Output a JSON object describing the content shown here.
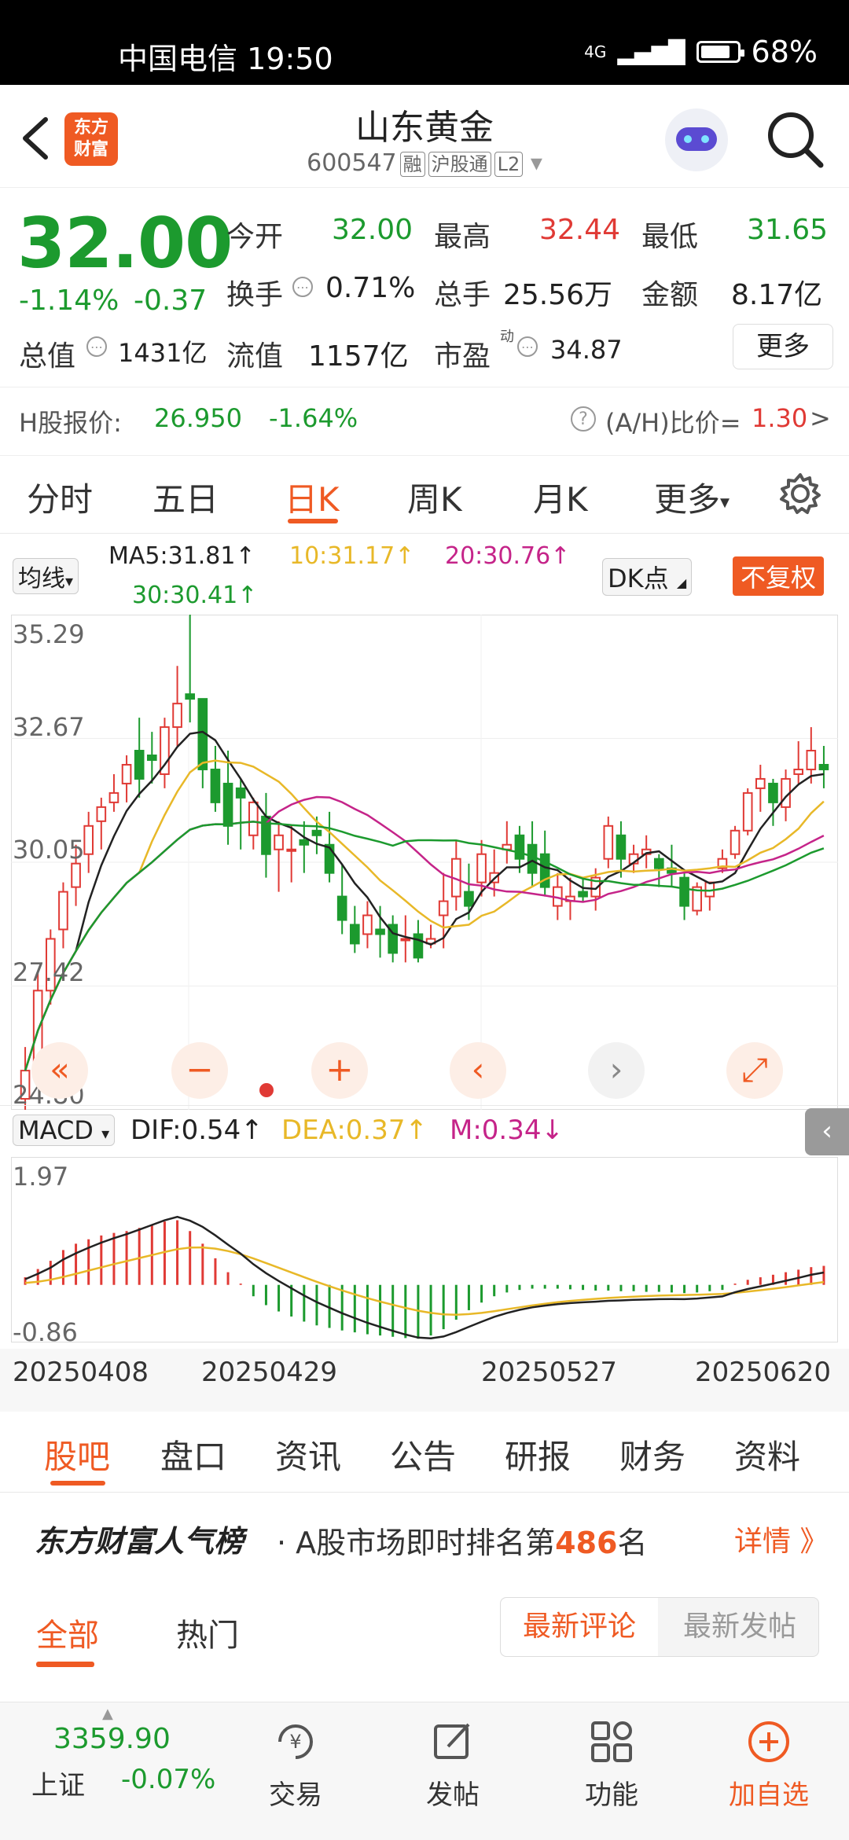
{
  "status": {
    "carrier": "中国电信",
    "time": "19:50",
    "network": "4G",
    "battery": "68%"
  },
  "header": {
    "logo_line1": "东方",
    "logo_line2": "财富",
    "title": "山东黄金",
    "code": "600547",
    "tags": [
      "融",
      "沪股通",
      "L2"
    ]
  },
  "quote": {
    "price": "32.00",
    "change_pct": "-1.14%",
    "change": "-0.37",
    "open_label": "今开",
    "open": "32.00",
    "high_label": "最高",
    "high": "32.44",
    "low_label": "最低",
    "low": "31.65",
    "turnover_label": "换手",
    "turnover": "0.71%",
    "volume_label": "总手",
    "volume": "25.56万",
    "amount_label": "金额",
    "amount": "8.17亿",
    "mcap_label": "总值",
    "mcap": "1431亿",
    "float_label": "流值",
    "float_cap": "1157亿",
    "pe_label": "市盈",
    "pe_sup": "动",
    "pe": "34.87",
    "more": "更多"
  },
  "hshare": {
    "label": "H股报价:",
    "price": "26.950",
    "pct": "-1.64%",
    "ratio_label": "(A/H)比价=",
    "ratio": "1.30",
    "arrow": ">"
  },
  "period_tabs": [
    "分时",
    "五日",
    "日K",
    "周K",
    "月K",
    "更多"
  ],
  "chart_header": {
    "ma_select": "均线",
    "ma5": "MA5:31.81↑",
    "ma10": "10:31.17↑",
    "ma20": "20:30.76↑",
    "ma30": "30:30.41↑",
    "dk": "DK点",
    "fq": "不复权"
  },
  "macd_header": {
    "select": "MACD",
    "dif": "DIF:0.54↑",
    "dea": "DEA:0.37↑",
    "m": "M:0.34↓"
  },
  "chart_data": [
    {
      "type": "candlestick",
      "ylim": [
        24.8,
        35.29
      ],
      "y_ticks": [
        "35.29",
        "32.67",
        "30.05",
        "27.42",
        "24.80"
      ],
      "ohlc": [
        [
          25.0,
          26.1,
          24.7,
          25.6
        ],
        [
          25.6,
          27.7,
          25.4,
          27.3
        ],
        [
          27.3,
          28.6,
          27.0,
          28.4
        ],
        [
          28.6,
          29.6,
          28.2,
          29.4
        ],
        [
          29.5,
          30.4,
          29.1,
          30.0
        ],
        [
          30.2,
          31.1,
          29.8,
          30.8
        ],
        [
          30.9,
          31.4,
          30.3,
          31.2
        ],
        [
          31.3,
          31.9,
          31.1,
          31.5
        ],
        [
          31.7,
          32.3,
          31.3,
          32.1
        ],
        [
          32.4,
          33.1,
          31.4,
          31.8
        ],
        [
          32.3,
          32.8,
          31.7,
          32.2
        ],
        [
          31.9,
          33.1,
          31.6,
          32.9
        ],
        [
          32.9,
          34.2,
          32.5,
          33.4
        ],
        [
          33.6,
          35.4,
          33.0,
          33.5
        ],
        [
          33.5,
          33.4,
          31.6,
          32.0
        ],
        [
          32.0,
          32.5,
          31.1,
          31.3
        ],
        [
          31.7,
          32.4,
          30.4,
          30.8
        ],
        [
          31.6,
          31.8,
          30.3,
          31.4
        ],
        [
          30.6,
          31.4,
          30.3,
          31.3
        ],
        [
          31.0,
          31.5,
          29.7,
          30.2
        ],
        [
          30.3,
          30.9,
          29.4,
          30.6
        ],
        [
          30.3,
          30.8,
          29.6,
          30.3
        ],
        [
          30.5,
          30.9,
          29.8,
          30.4
        ],
        [
          30.7,
          31.0,
          30.2,
          30.6
        ],
        [
          30.4,
          31.1,
          29.6,
          29.8
        ],
        [
          29.3,
          30.0,
          28.5,
          28.8
        ],
        [
          28.7,
          29.1,
          28.1,
          28.3
        ],
        [
          28.5,
          29.2,
          28.2,
          28.9
        ],
        [
          28.6,
          29.1,
          28.0,
          28.5
        ],
        [
          28.7,
          28.9,
          27.9,
          28.1
        ],
        [
          28.4,
          28.9,
          27.9,
          28.4
        ],
        [
          28.5,
          28.8,
          27.9,
          28.0
        ],
        [
          28.3,
          28.7,
          28.2,
          28.4
        ],
        [
          28.9,
          29.8,
          28.2,
          29.2
        ],
        [
          29.3,
          30.5,
          29.0,
          30.1
        ],
        [
          29.4,
          30.0,
          28.8,
          29.1
        ],
        [
          29.6,
          30.5,
          29.3,
          30.2
        ],
        [
          29.6,
          30.3,
          29.3,
          29.8
        ],
        [
          30.3,
          30.9,
          30.0,
          30.4
        ],
        [
          30.6,
          30.8,
          29.8,
          30.1
        ],
        [
          30.4,
          30.9,
          29.5,
          29.8
        ],
        [
          30.2,
          30.7,
          29.3,
          29.5
        ],
        [
          29.1,
          29.8,
          28.8,
          29.5
        ],
        [
          29.2,
          29.7,
          28.8,
          29.3
        ],
        [
          29.4,
          29.7,
          29.2,
          29.3
        ],
        [
          29.3,
          29.9,
          29.0,
          29.7
        ],
        [
          30.1,
          31.0,
          29.9,
          30.8
        ],
        [
          30.6,
          30.9,
          29.7,
          30.1
        ],
        [
          30.0,
          30.4,
          29.8,
          30.2
        ],
        [
          30.2,
          30.6,
          29.9,
          30.3
        ],
        [
          30.1,
          30.2,
          29.5,
          29.9
        ],
        [
          29.9,
          30.4,
          29.5,
          29.8
        ],
        [
          29.7,
          29.8,
          28.8,
          29.1
        ],
        [
          29.0,
          29.6,
          28.9,
          29.5
        ],
        [
          29.3,
          29.6,
          29.0,
          29.6
        ],
        [
          29.9,
          30.3,
          29.8,
          30.1
        ],
        [
          30.2,
          30.8,
          30.1,
          30.7
        ],
        [
          30.7,
          31.6,
          30.6,
          31.5
        ],
        [
          31.6,
          32.1,
          31.1,
          31.8
        ],
        [
          31.7,
          31.8,
          30.8,
          31.3
        ],
        [
          31.2,
          32.0,
          30.9,
          31.8
        ],
        [
          31.9,
          32.6,
          31.7,
          32.0
        ],
        [
          32.0,
          32.9,
          31.7,
          32.4
        ],
        [
          32.1,
          32.5,
          31.6,
          32.0
        ]
      ],
      "x_labels": [
        "20250408",
        "20250429",
        "20250527",
        "20250620"
      ]
    },
    {
      "type": "bar",
      "title": "MACD",
      "ylim": [
        -0.86,
        1.97
      ],
      "y_ticks": [
        "1.97",
        "-0.86"
      ],
      "m": [
        0.12,
        0.25,
        0.38,
        0.55,
        0.65,
        0.72,
        0.78,
        0.82,
        0.85,
        0.9,
        0.95,
        1.0,
        1.02,
        0.85,
        0.65,
        0.42,
        0.2,
        0.02,
        -0.18,
        -0.32,
        -0.42,
        -0.5,
        -0.58,
        -0.64,
        -0.68,
        -0.72,
        -0.75,
        -0.78,
        -0.8,
        -0.82,
        -0.84,
        -0.85,
        -0.8,
        -0.7,
        -0.55,
        -0.4,
        -0.28,
        -0.18,
        -0.12,
        -0.08,
        -0.06,
        -0.06,
        -0.06,
        -0.07,
        -0.08,
        -0.09,
        -0.09,
        -0.1,
        -0.1,
        -0.11,
        -0.11,
        -0.12,
        -0.13,
        -0.12,
        -0.1,
        -0.08,
        0.02,
        0.08,
        0.12,
        0.16,
        0.2,
        0.24,
        0.28,
        0.3
      ]
    }
  ],
  "chart_controls": [
    "«",
    "−",
    "+",
    "‹",
    "›",
    "⤢"
  ],
  "lower_tabs": [
    "股吧",
    "盘口",
    "资讯",
    "公告",
    "研报",
    "财务",
    "资料"
  ],
  "rank": {
    "title": "东方财富人气榜",
    "text": "· A股市场即时排名第",
    "num": "486",
    "suffix": "名",
    "detail": "详情 》"
  },
  "filter": {
    "all": "全部",
    "hot": "热门",
    "latest_comment": "最新评论",
    "latest_post": "最新发帖"
  },
  "market": {
    "value": "3359.90",
    "name": "上证",
    "pct": "-0.07%"
  },
  "nav": [
    "交易",
    "发帖",
    "功能",
    "加自选"
  ],
  "colors": {
    "up": "#e03a35",
    "down": "#1c9a2e",
    "accent": "#ef5a23",
    "ma5": "#222222",
    "ma10": "#e8b828",
    "ma20": "#c52489",
    "ma30": "#1c9a2e"
  }
}
